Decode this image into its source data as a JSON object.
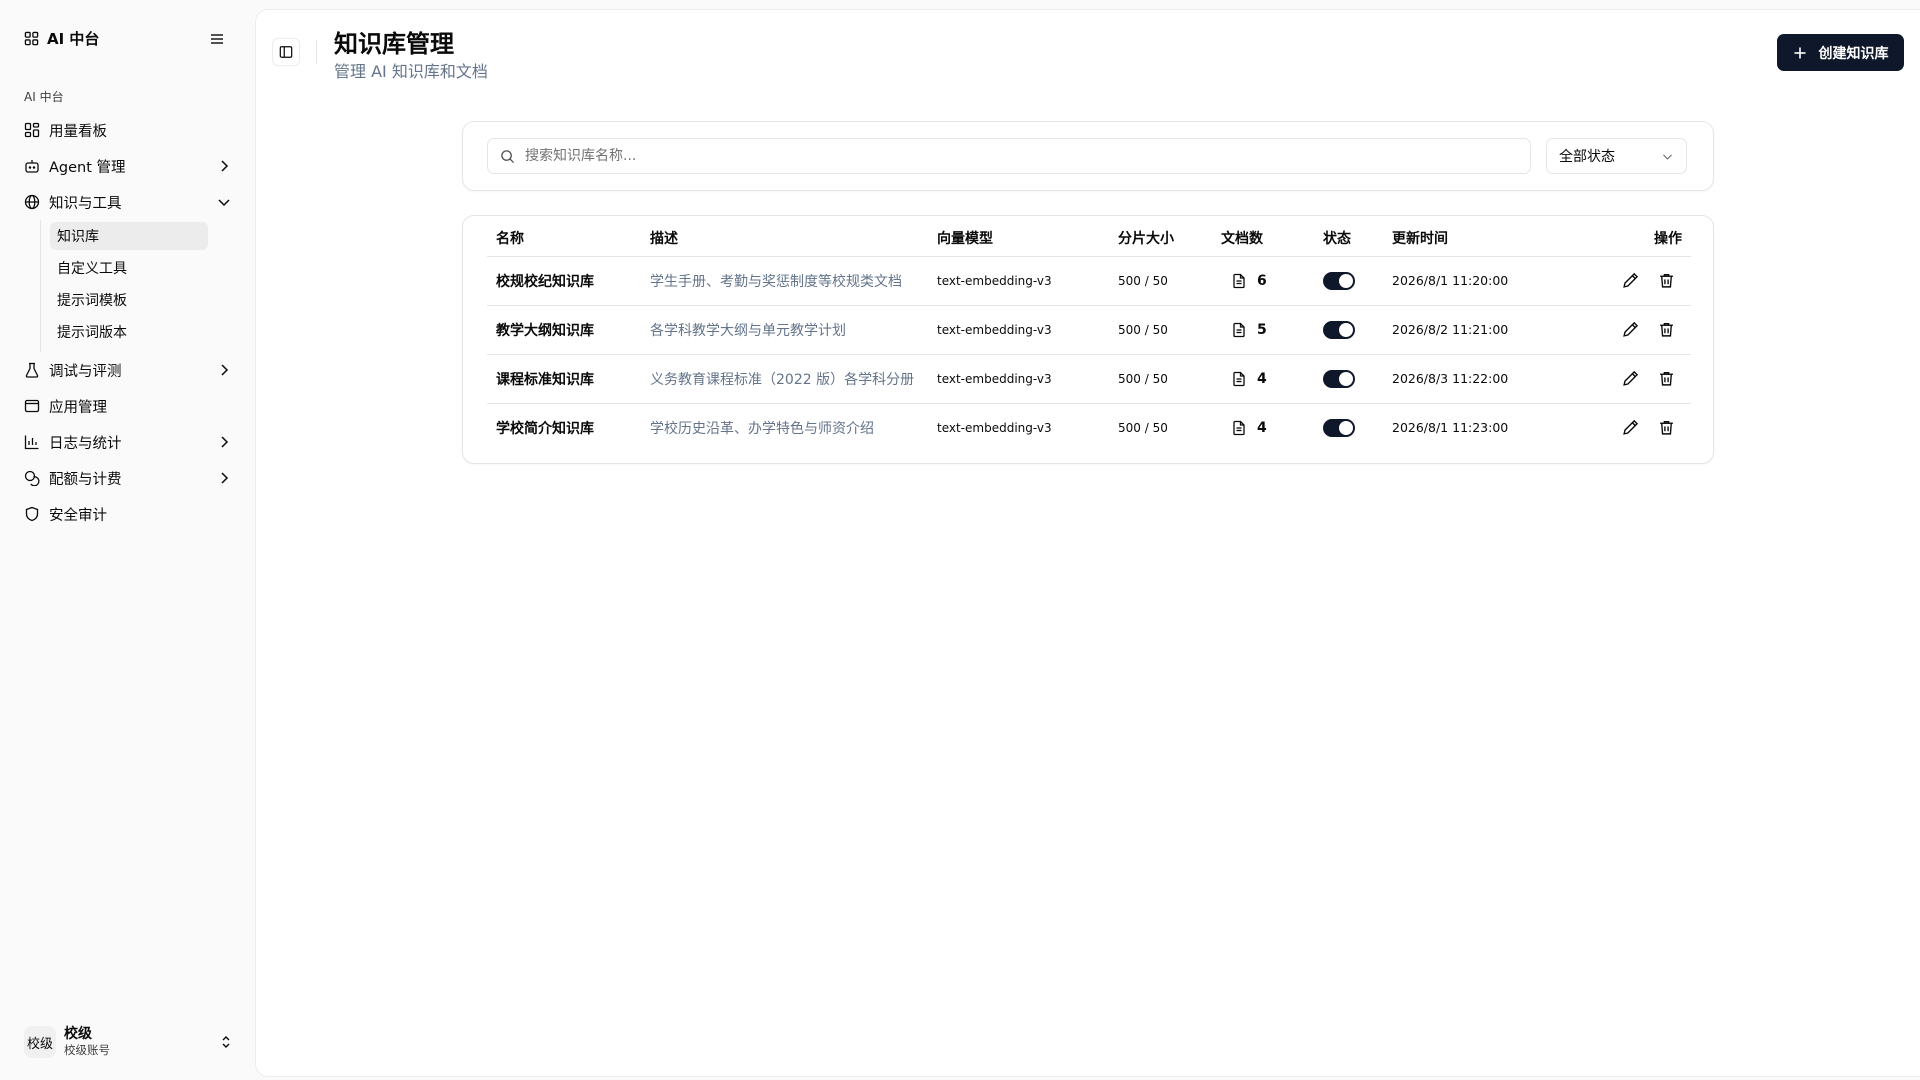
{
  "sidebar": {
    "brand": "AI 中台",
    "group_label": "AI 中台",
    "items": [
      {
        "label": "用量看板",
        "icon": "dashboard-icon"
      },
      {
        "label": "Agent 管理",
        "icon": "bot-icon",
        "expandable": true
      },
      {
        "label": "知识与工具",
        "icon": "globe-icon",
        "expanded": true,
        "children": [
          "知识库",
          "自定义工具",
          "提示词模板",
          "提示词版本"
        ],
        "active_child": "知识库"
      },
      {
        "label": "调试与评测",
        "icon": "flask-icon",
        "expandable": true
      },
      {
        "label": "应用管理",
        "icon": "app-window-icon"
      },
      {
        "label": "日志与统计",
        "icon": "bar-chart-icon",
        "expandable": true
      },
      {
        "label": "配额与计费",
        "icon": "coins-icon",
        "expandable": true
      },
      {
        "label": "安全审计",
        "icon": "shield-icon"
      }
    ],
    "user": {
      "avatar": "校级",
      "name": "校级",
      "sub": "校级账号"
    }
  },
  "header": {
    "title": "知识库管理",
    "subtitle": "管理 AI 知识库和文档",
    "create_label": "创建知识库"
  },
  "filter": {
    "search_placeholder": "搜索知识库名称...",
    "status_value": "全部状态"
  },
  "table": {
    "columns": [
      "名称",
      "描述",
      "向量模型",
      "分片大小",
      "文档数",
      "状态",
      "更新时间",
      "操作"
    ],
    "rows": [
      {
        "name": "校规校纪知识库",
        "desc": "学生手册、考勤与奖惩制度等校规类文档",
        "model": "text-embedding-v3",
        "chunk": "500 / 50",
        "docs": "6",
        "enabled": true,
        "updated": "2026/8/1 11:20:00"
      },
      {
        "name": "教学大纲知识库",
        "desc": "各学科教学大纲与单元教学计划",
        "model": "text-embedding-v3",
        "chunk": "500 / 50",
        "docs": "5",
        "enabled": true,
        "updated": "2026/8/2 11:21:00"
      },
      {
        "name": "课程标准知识库",
        "desc": "义务教育课程标准（2022 版）各学科分册",
        "model": "text-embedding-v3",
        "chunk": "500 / 50",
        "docs": "4",
        "enabled": true,
        "updated": "2026/8/3 11:22:00"
      },
      {
        "name": "学校简介知识库",
        "desc": "学校历史沿革、办学特色与师资介绍",
        "model": "text-embedding-v3",
        "chunk": "500 / 50",
        "docs": "4",
        "enabled": true,
        "updated": "2026/8/1 11:23:00"
      }
    ]
  },
  "colors": {
    "primary": "#0f172a",
    "muted_text": "#64748b",
    "border": "#e5e5e5",
    "active_bg": "#ececec"
  }
}
